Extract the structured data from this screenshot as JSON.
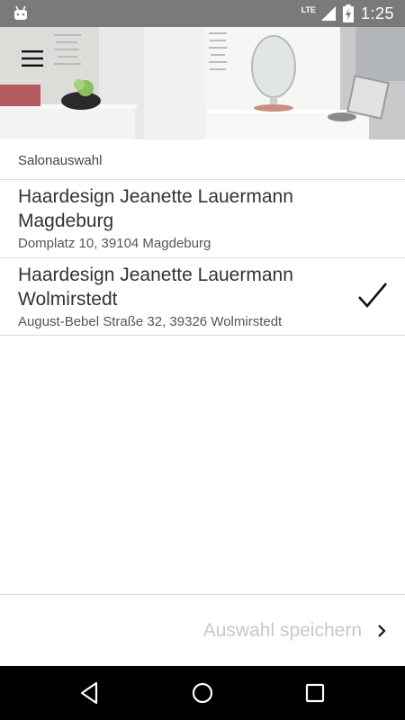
{
  "status_bar": {
    "network": "LTE",
    "time": "1:25"
  },
  "header": {
    "menu_icon": "hamburger-menu-icon"
  },
  "salon_selection": {
    "label": "Salonauswahl",
    "salons": [
      {
        "name": "Haardesign Jeanette Lauermann Magdeburg",
        "address": "Domplatz 10, 39104 Magdeburg",
        "selected": false
      },
      {
        "name": "Haardesign Jeanette Lauermann Wolmirstedt",
        "address": "August-Bebel Straße 32, 39326 Wolmirstedt",
        "selected": true
      }
    ]
  },
  "footer": {
    "save_label": "Auswahl speichern"
  },
  "colors": {
    "status_bar": "#7a7a7a",
    "nav_bar": "#000000",
    "divider": "#dcdcdc",
    "disabled_text": "#c8c8c8"
  }
}
